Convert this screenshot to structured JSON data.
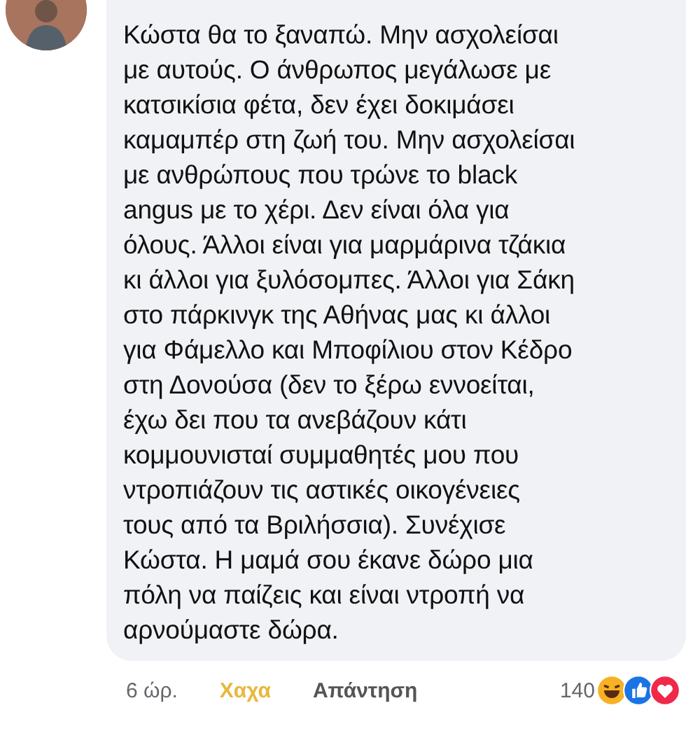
{
  "comment": {
    "lines": [
      "Κώστα θα το ξαναπώ. Μην ασχολείσαι",
      "με αυτούς. Ο άνθρωπος μεγάλωσε με",
      "κατσικίσια φέτα, δεν έχει δοκιμάσει",
      "καμαμπέρ στη ζωή του. Μην ασχολείσαι",
      "με ανθρώπους που τρώνε το black",
      "angus με το χέρι. Δεν είναι όλα για",
      "όλους. Άλλοι είναι για μαρμάρινα τζάκια",
      "κι άλλοι για ξυλόσομπες. Άλλοι για Σάκη",
      "στο πάρκινγκ της Αθήνας μας κι άλλοι",
      "για Φάμελλο και Μποφίλιου στον Κέδρο",
      "στη Δονούσα (δεν το ξέρω εννοείται,",
      "έχω δει που τα ανεβάζουν κάτι",
      "κομμουνισταί συμμαθητές μου που",
      "ντροπιάζουν τις αστικές οικογένειες",
      "τους από τα Βριλήσσια). Συνέχισε",
      "Κώστα. Η μαμά σου έκανε δώρο μια",
      "πόλη να παίζεις και είναι ντροπή να",
      "αρνούμαστε δώρα."
    ]
  },
  "footer": {
    "time": "6 ώρ.",
    "reaction": {
      "label": "Χαχα",
      "reacted": true
    },
    "reply": "Απάντηση",
    "reaction_count": "140",
    "reactions": [
      {
        "kind": "haha"
      },
      {
        "kind": "like"
      },
      {
        "kind": "love"
      }
    ]
  }
}
